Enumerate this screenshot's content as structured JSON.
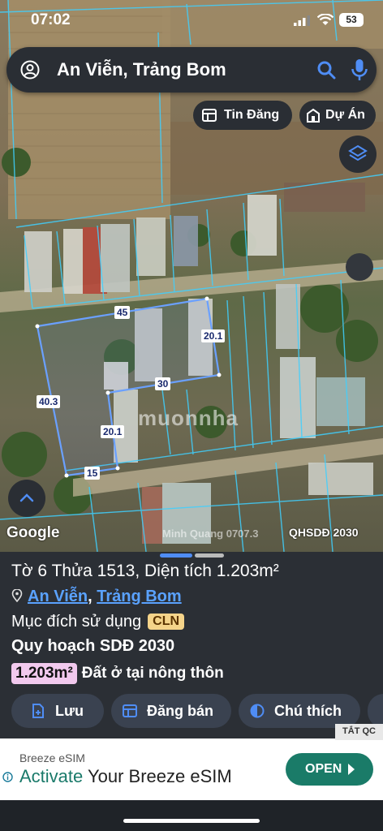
{
  "status_bar": {
    "time": "07:02",
    "battery": "53"
  },
  "search": {
    "query": "An Viễn, Trảng Bom"
  },
  "chips": {
    "tin_dang": "Tin Đăng",
    "du_an": "Dự Án"
  },
  "parcel_labels": [
    "45",
    "20.1",
    "30",
    "40.3",
    "20.1",
    "15"
  ],
  "map": {
    "watermark": "muonnha",
    "google": "Google",
    "credit": "Minh Quang 0707.3",
    "layer_name": "QHSDĐ 2030"
  },
  "sheet": {
    "title": "Tờ 6 Thửa 1513, Diện tích 1.203m²",
    "location": {
      "commune": "An Viễn",
      "separator": ",",
      "district": "Trảng Bom"
    },
    "purpose_label": "Mục đích sử dụng",
    "purpose_code": "CLN",
    "plan_label": "Quy hoạch SDĐ 2030",
    "area_badge": "1.203m²",
    "area_desc": "Đất ở tại nông thôn",
    "actions": {
      "save": "Lưu",
      "post_sale": "Đăng bán",
      "legend": "Chú thích"
    }
  },
  "ad": {
    "tag": "TẮT QC",
    "brand": "Breeze eSIM",
    "headline_accent": "Activate",
    "headline_rest": " Your Breeze eSIM",
    "cta": "OPEN"
  },
  "colors": {
    "accent": "#4f8df5",
    "link": "#5aa2ff",
    "cta": "#1a7b68",
    "parcel_line": "#3fd0ff",
    "selected_parcel": "#6aa0ff"
  }
}
